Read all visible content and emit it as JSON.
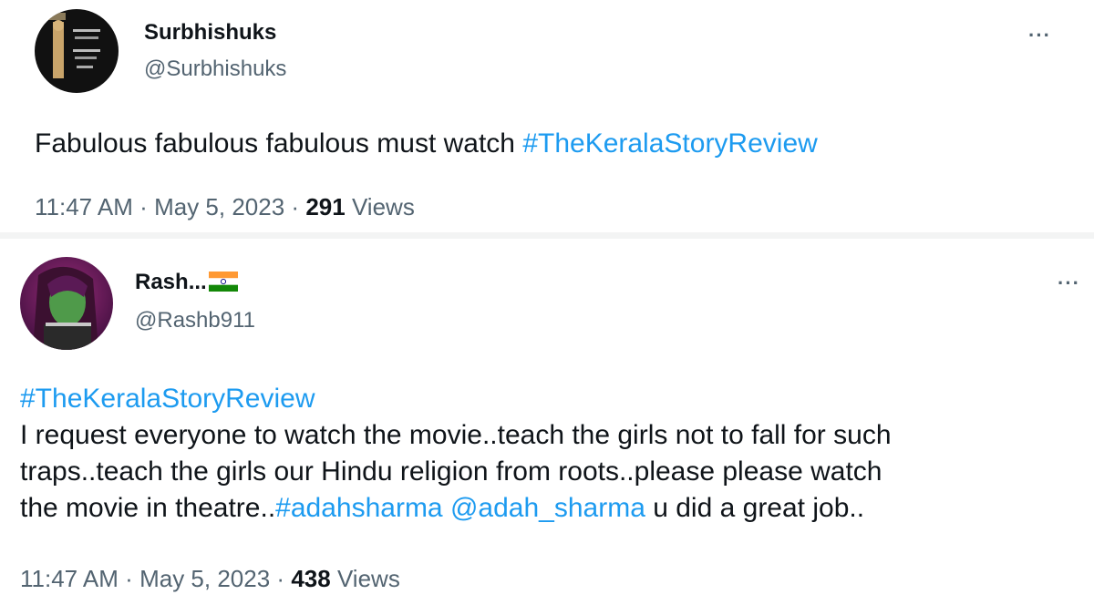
{
  "tweets": [
    {
      "display_name": "Surbhishuks",
      "handle": "@Surbhishuks",
      "more_label": "···",
      "text_plain": "Fabulous fabulous fabulous must watch ",
      "hashtag": "#TheKeralaStoryReview",
      "time": "11:47 AM",
      "separator": "·",
      "date": "May 5, 2023",
      "views_count": "291",
      "views_label": "Views",
      "avatar_icon": "avatar-photo-icon"
    },
    {
      "display_name": "Rash...",
      "flag_icon": "india-flag-icon",
      "handle": "@Rashb911",
      "more_label": "···",
      "hashtag_line": "#TheKeralaStoryReview",
      "line1": "I request everyone to watch the movie..teach the girls not to fall for such",
      "line2": "traps..teach the girls our Hindu religion from roots..please please watch",
      "line3_pre": "the movie in theatre..",
      "line3_hashtag": "#adahsharma",
      "line3_mention": "@adah_sharma",
      "line3_post": " u did a great job..",
      "time": "11:47 AM",
      "separator": "·",
      "date": "May 5, 2023",
      "views_count": "438",
      "views_label": "Views",
      "avatar_icon": "avatar-photo-icon"
    }
  ],
  "colors": {
    "link": "#1d9bf0",
    "secondary_text": "#536471",
    "primary_text": "#0f1419"
  }
}
